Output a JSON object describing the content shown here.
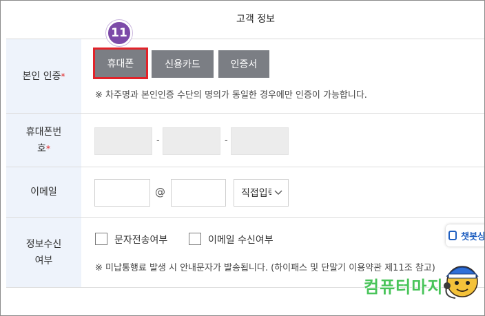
{
  "header": {
    "title": "고객 정보"
  },
  "step_badge": "11",
  "auth": {
    "label": "본인 인증",
    "required_mark": "*",
    "buttons": [
      {
        "label": "휴대폰",
        "selected": true
      },
      {
        "label": "신용카드",
        "selected": false
      },
      {
        "label": "인증서",
        "selected": false
      }
    ],
    "notice": "※ 차주명과 본인인증 수단의 명의가 동일한 경우에만 인증이 가능합니다."
  },
  "phone": {
    "label_line1": "휴대폰번",
    "label_line2": "호",
    "required_mark": "*",
    "separator": "-",
    "part1": "",
    "part2": "",
    "part3": ""
  },
  "email": {
    "label": "이메일",
    "local_part": "",
    "at_sign": "@",
    "domain": "",
    "domain_select": "직접입력"
  },
  "consent": {
    "label_line1": "정보수신",
    "label_line2": "여부",
    "option_sms": "문자전송여부",
    "option_email": "이메일 수신여부",
    "notice": "※ 미납통행료 발생 시 안내문자가 발송됩니다. (하이패스 및 단말기 이용약관 제11조 참고)"
  },
  "overlay": {
    "chatbot_label": "챗봇상담",
    "watermark_text": "컴퓨터마지",
    "colors": {
      "badge": "#7c4aa8",
      "selected_outline": "#e2232a",
      "button_bg": "#7b7e84",
      "label_bg": "#eef3fb"
    }
  }
}
